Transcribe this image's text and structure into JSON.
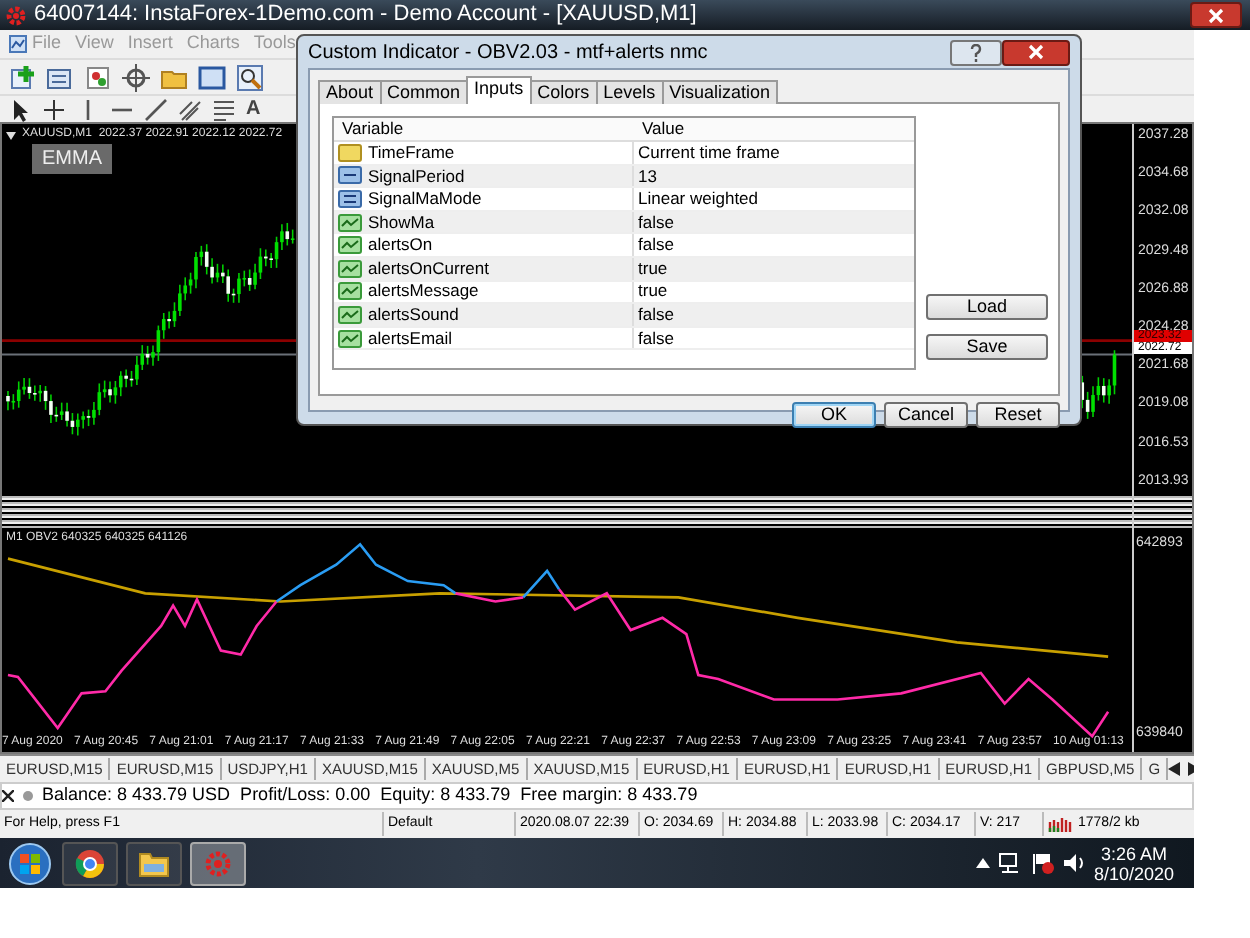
{
  "window": {
    "title": "64007144: InstaForex-1Demo.com - Demo Account - [XAUUSD,M1]"
  },
  "menu": [
    "File",
    "View",
    "Insert",
    "Charts",
    "Tools"
  ],
  "drawing_tools": {
    "text_tool": "A"
  },
  "chart": {
    "header": "XAUUSD,M1  2022.37 2022.91 2022.12 2022.72",
    "label": "EMMA",
    "price_axis": [
      "2037.28",
      "2034.68",
      "2032.08",
      "2029.48",
      "2026.88",
      "2024.28",
      "2021.68",
      "2019.08",
      "2016.53",
      "2013.93"
    ],
    "price_tags": [
      {
        "kind": "ask",
        "text": "2023.32"
      },
      {
        "kind": "bid",
        "text": "2022.72"
      }
    ]
  },
  "indicator_pane": {
    "header": "M1 OBV2 640325 640325 641126",
    "axis": [
      "642893",
      "639840"
    ],
    "time_axis": [
      "7 Aug 2020",
      "7 Aug 20:45",
      "7 Aug 21:01",
      "7 Aug 21:17",
      "7 Aug 21:33",
      "7 Aug 21:49",
      "7 Aug 22:05",
      "7 Aug 22:21",
      "7 Aug 22:37",
      "7 Aug 22:53",
      "7 Aug 23:09",
      "7 Aug 23:25",
      "7 Aug 23:41",
      "7 Aug 23:57",
      "10 Aug 01:13"
    ]
  },
  "dialog": {
    "title": "Custom Indicator - OBV2.03 - mtf+alerts nmc",
    "tabs": [
      {
        "label": "About",
        "selected": false
      },
      {
        "label": "Common",
        "selected": false
      },
      {
        "label": "Inputs",
        "selected": true
      },
      {
        "label": "Colors",
        "selected": false
      },
      {
        "label": "Levels",
        "selected": false
      },
      {
        "label": "Visualization",
        "selected": false
      }
    ],
    "columns": [
      "Variable",
      "Value"
    ],
    "rows": [
      {
        "kind": "string",
        "name": "TimeFrame",
        "value": "Current time frame"
      },
      {
        "kind": "int",
        "name": "SignalPeriod",
        "value": "13"
      },
      {
        "kind": "enum",
        "name": "SignalMaMode",
        "value": "Linear weighted"
      },
      {
        "kind": "bool",
        "name": "ShowMa",
        "value": "false"
      },
      {
        "kind": "bool",
        "name": "alertsOn",
        "value": "false"
      },
      {
        "kind": "bool",
        "name": "alertsOnCurrent",
        "value": "true"
      },
      {
        "kind": "bool",
        "name": "alertsMessage",
        "value": "true"
      },
      {
        "kind": "bool",
        "name": "alertsSound",
        "value": "false"
      },
      {
        "kind": "bool",
        "name": "alertsEmail",
        "value": "false"
      }
    ],
    "side_buttons": [
      "Load",
      "Save"
    ],
    "buttons": [
      {
        "label": "OK",
        "default": true
      },
      {
        "label": "Cancel",
        "default": false
      },
      {
        "label": "Reset",
        "default": false
      }
    ]
  },
  "symbol_tabs": [
    "EURUSD,M15",
    "EURUSD,M15",
    "USDJPY,H1",
    "XAUUSD,M15",
    "XAUUSD,M5",
    "XAUUSD,M15",
    "EURUSD,H1",
    "EURUSD,H1",
    "EURUSD,H1",
    "EURUSD,H1",
    "GBPUSD,M5",
    "G"
  ],
  "terminal": {
    "text": "Balance: 8 433.79 USD  Profit/Loss: 0.00  Equity: 8 433.79  Free margin: 8 433.79"
  },
  "status_bar": [
    "For Help, press F1",
    "Default",
    "2020.08.07 22:39",
    "O: 2034.69",
    "H: 2034.88",
    "L: 2033.98",
    "C: 2034.17",
    "V: 217",
    "1778/2 kb"
  ],
  "taskbar": {
    "apps": [
      {
        "kind": "browser",
        "active": false
      },
      {
        "kind": "folder",
        "active": false
      },
      {
        "kind": "trading",
        "active": true
      }
    ],
    "time": "3:26 AM",
    "date": "8/10/2020"
  }
}
